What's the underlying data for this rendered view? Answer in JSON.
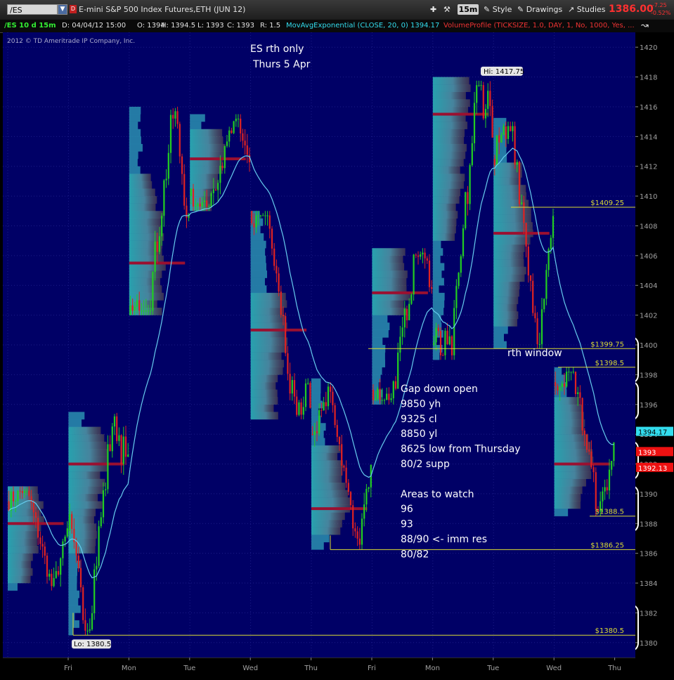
{
  "toolbar": {
    "symbol": "/ES",
    "description": "E-mini S&P 500 Index Futures,ETH (JUN 12)",
    "timeframe": "15m",
    "style_label": "Style",
    "drawings_label": "Drawings",
    "studies_label": "Studies",
    "last_price": "1386.00",
    "change": "-7.25",
    "change_pct": "-0.52%"
  },
  "infobar": {
    "chart_name": "/ES 10 d 15m",
    "date": "D: 04/04/12 15:00",
    "open": "O: 1394",
    "high": "H: 1394.5",
    "low": "L: 1393",
    "close": "C: 1393",
    "range": "R: 1.5",
    "study1": "MovAvgExponential (CLOSE, 20, 0)",
    "study1_value": "1394.17",
    "study2": "VolumeProfile (TICKSIZE, 1.0, DAY, 1, No, 1000, Yes, ..."
  },
  "colors": {
    "background": "#000066",
    "candle_up": "#22cc22",
    "candle_down": "#dd2222",
    "ema": "#66ccee",
    "level_line": "#dddd33",
    "poc": "#9a1030"
  },
  "chart_data": {
    "type": "candlestick",
    "watermark": "2012 © TD Ameritrade IP Company, Inc.",
    "x_labels": [
      "Fri",
      "Mon",
      "Tue",
      "Wed",
      "Thu",
      "Fri",
      "Mon",
      "Tue",
      "Wed",
      "Thu"
    ],
    "ylim": [
      1379,
      1421
    ],
    "y_ticks": [
      1380,
      1382,
      1384,
      1386,
      1388,
      1390,
      1392,
      1394,
      1396,
      1398,
      1400,
      1402,
      1404,
      1406,
      1408,
      1410,
      1412,
      1414,
      1416,
      1418,
      1420
    ],
    "grid": true,
    "sessions": [
      {
        "label": "Thu",
        "open": 1389.5,
        "high": 1390.5,
        "low": 1383.5,
        "close": 1387.5,
        "poc": 1388,
        "va": [
          1384,
          1391
        ]
      },
      {
        "label": "Fri",
        "open": 1387.5,
        "high": 1395.5,
        "low": 1380.5,
        "close": 1391.5,
        "poc": 1392,
        "va": [
          1386,
          1394
        ]
      },
      {
        "label": "Mon",
        "open": 1402,
        "high": 1416,
        "low": 1402,
        "close": 1408,
        "poc": 1405.5,
        "va": [
          1402,
          1411
        ]
      },
      {
        "label": "Tue",
        "open": 1410,
        "high": 1415.5,
        "low": 1409,
        "close": 1412,
        "poc": 1412.5,
        "va": [
          1408,
          1414
        ]
      },
      {
        "label": "Wed",
        "open": 1409,
        "high": 1409,
        "low": 1395,
        "close": 1397,
        "poc": 1401,
        "va": [
          1395,
          1403
        ]
      },
      {
        "label": "Thu",
        "open": 1394,
        "high": 1397.5,
        "low": 1386.25,
        "close": 1391,
        "poc": 1389,
        "va": [
          1387,
          1393
        ]
      },
      {
        "label": "Fri",
        "open": 1397,
        "high": 1406.5,
        "low": 1396,
        "close": 1404.5,
        "poc": 1403.5,
        "va": [
          1402,
          1406
        ]
      },
      {
        "label": "Mon",
        "open": 1400,
        "high": 1417.75,
        "low": 1399,
        "close": 1415.5,
        "poc": 1415.5,
        "va": [
          1407,
          1418
        ]
      },
      {
        "label": "Tue",
        "open": 1412.5,
        "high": 1415,
        "low": 1399.75,
        "close": 1408,
        "poc": 1407.5,
        "va": [
          1401,
          1412
        ]
      },
      {
        "label": "Wed",
        "open": 1397.5,
        "high": 1398.5,
        "low": 1388.5,
        "close": 1393,
        "poc": 1392,
        "va": [
          1389,
          1396
        ]
      }
    ],
    "ema_period": 20,
    "ema_last": 1394.17,
    "levels": [
      {
        "price": 1409.25,
        "label": "$1409.25"
      },
      {
        "price": 1399.75,
        "label": "$1399.75"
      },
      {
        "price": 1398.5,
        "label": "$1398.5"
      },
      {
        "price": 1388.5,
        "label": "$1388.5"
      },
      {
        "price": 1386.25,
        "label": "$1386.25"
      },
      {
        "price": 1380.5,
        "label": "$1380.5"
      }
    ],
    "hi_label": "Hi: 1417.75",
    "lo_label": "Lo: 1380.5",
    "price_tags": [
      {
        "price": 1394.17,
        "label": "1394.17",
        "bg": "#33ddee",
        "fg": "#000000"
      },
      {
        "price": 1393,
        "label": "1393",
        "bg": "#ee1111",
        "fg": "#ffffff"
      },
      {
        "price": 1392.13,
        "label": "1392.13",
        "bg": "#ee1111",
        "fg": "#ffffff"
      }
    ],
    "annotations": {
      "title_lines": [
        "ES rth only",
        "Thurs 5 Apr"
      ],
      "rth_window": "rth window",
      "notes": [
        "Gap down open",
        "9850 yh",
        "9325 cl",
        "8850 yl",
        "8625 low from Thursday",
        "80/2 supp",
        "",
        "Areas to watch",
        "96",
        "93",
        "88/90 <- imm res",
        "80/82"
      ]
    },
    "ovals": [
      {
        "low": 1397.5,
        "high": 1400.5
      },
      {
        "low": 1395,
        "high": 1397.5
      },
      {
        "low": 1391,
        "high": 1393.5
      },
      {
        "low": 1387.5,
        "high": 1390.5
      },
      {
        "low": 1379.5,
        "high": 1382.5
      }
    ]
  }
}
